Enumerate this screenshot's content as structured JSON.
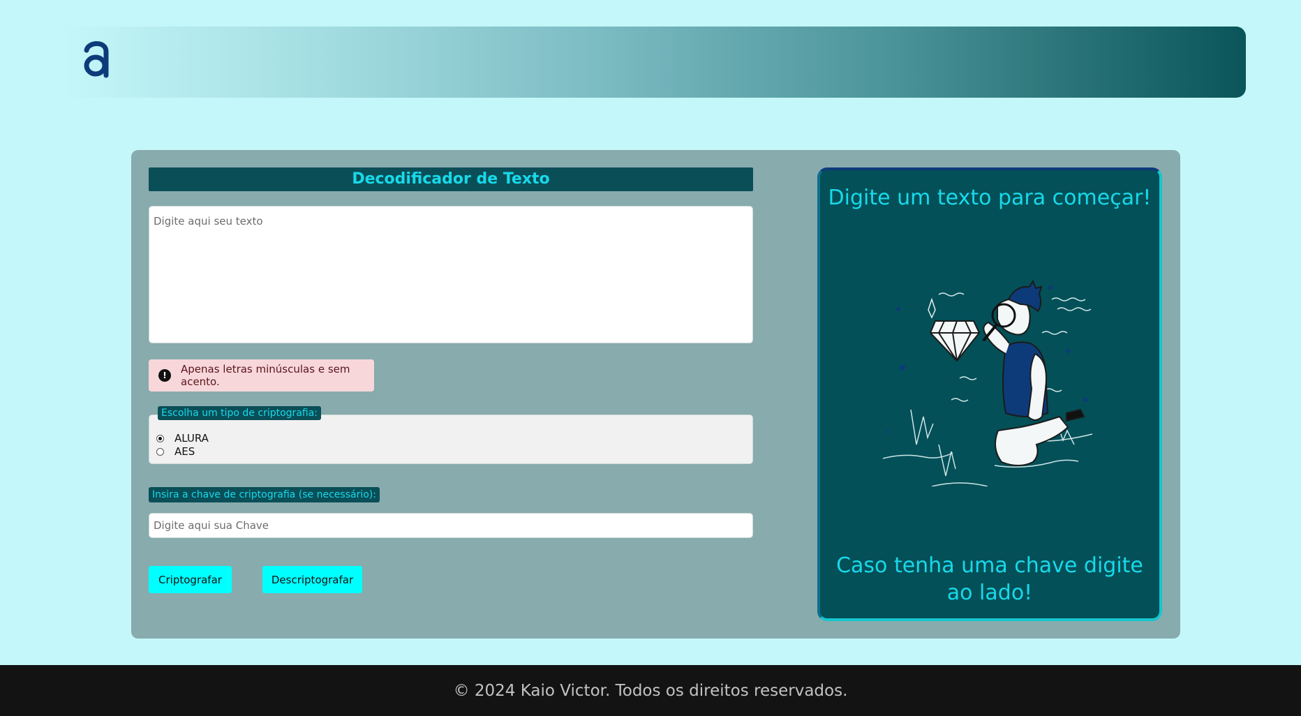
{
  "header": {
    "logo_icon": "alura-logo-icon"
  },
  "form": {
    "title": "Decodificador de Texto",
    "text_placeholder": "Digite aqui seu texto",
    "alert_text": "Apenas letras minúsculas e sem acento.",
    "alert_icon": "exclamation-circle-icon",
    "crypto_legend": "Escolha um tipo de criptografia:",
    "options": [
      {
        "label": "ALURA",
        "checked": true
      },
      {
        "label": "AES",
        "checked": false
      }
    ],
    "key_label": "Insira a chave de criptografia (se necessário):",
    "key_placeholder": "Digite aqui sua Chave",
    "encrypt_label": "Criptografar",
    "decrypt_label": "Descriptografar"
  },
  "output": {
    "top_message": "Digite um texto para começar!",
    "bottom_message": "Caso tenha uma chave digite ao lado!",
    "illustration": "person-with-magnifying-glass-diamond-illustration"
  },
  "footer": {
    "text": "© 2024 Kaio Victor. Todos os direitos reservados."
  },
  "colors": {
    "background": "#c4f7f9",
    "accent": "#18d9ea",
    "dark_teal": "#0a4e57",
    "button": "#00ffff",
    "footer": "#131313"
  }
}
